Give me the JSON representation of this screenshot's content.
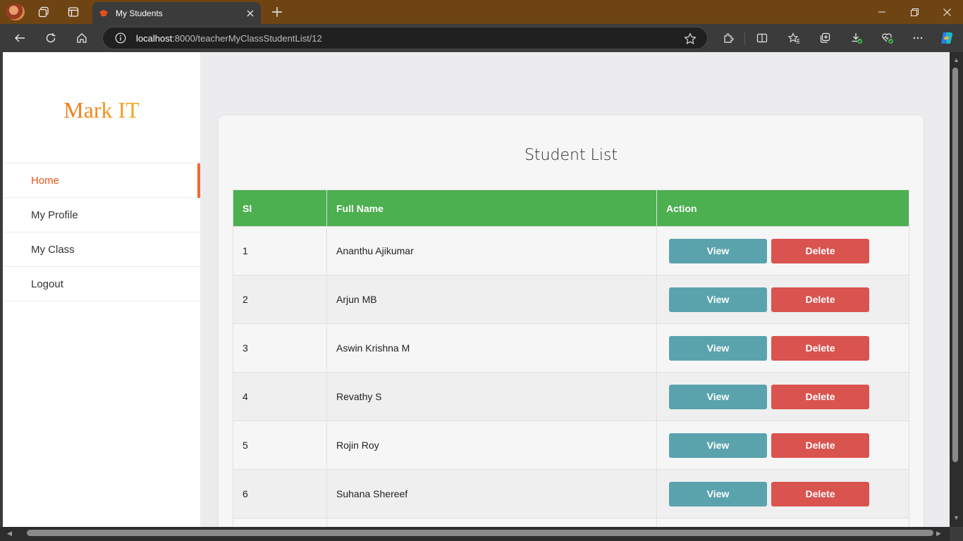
{
  "browser": {
    "tab_title": "My Students",
    "url_host": "localhost",
    "url_rest": ":8000/teacherMyClassStudentList/12",
    "icons": {
      "profile": "profile-avatar",
      "workspaces": "workspaces-icon",
      "tab_actions": "vertical-tabs-icon",
      "favicon": "graduation-cap-icon",
      "close": "close-icon",
      "new_tab": "plus-icon",
      "back": "back-arrow-icon",
      "refresh": "refresh-icon",
      "home": "home-icon",
      "info": "info-icon",
      "favorite": "star-icon"
    }
  },
  "sidebar": {
    "logo": "Mark IT",
    "items": [
      {
        "label": "Home",
        "active": true
      },
      {
        "label": "My Profile",
        "active": false
      },
      {
        "label": "My Class",
        "active": false
      },
      {
        "label": "Logout",
        "active": false
      }
    ]
  },
  "main": {
    "title": "Student List",
    "columns": [
      "Sl",
      "Full Name",
      "Action"
    ],
    "rows": [
      {
        "sl": "1",
        "name": "Ananthu Ajikumar"
      },
      {
        "sl": "2",
        "name": "Arjun MB"
      },
      {
        "sl": "3",
        "name": "Aswin Krishna M"
      },
      {
        "sl": "4",
        "name": "Revathy S"
      },
      {
        "sl": "5",
        "name": "Rojin Roy"
      },
      {
        "sl": "6",
        "name": "Suhana Shereef"
      }
    ],
    "view_label": "View",
    "delete_label": "Delete"
  },
  "colors": {
    "header_green": "#4caf50",
    "view_teal": "#5aa3ad",
    "delete_red": "#d9534f",
    "active_orange": "#e5531a",
    "titlebar_brown": "#6e4413"
  }
}
